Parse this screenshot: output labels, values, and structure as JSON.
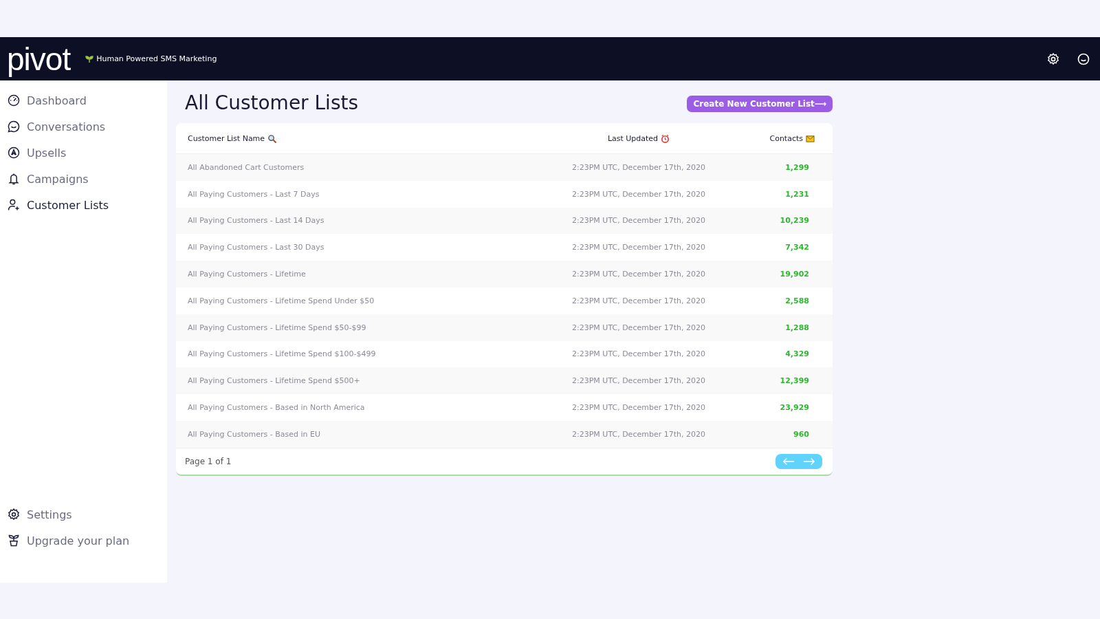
{
  "header": {
    "logo": "pivot",
    "tagline": "Human Powered SMS Marketing"
  },
  "sidebar": {
    "items": [
      {
        "label": "Dashboard",
        "selected": false
      },
      {
        "label": "Conversations",
        "selected": false
      },
      {
        "label": "Upsells",
        "selected": false
      },
      {
        "label": "Campaigns",
        "selected": false
      },
      {
        "label": "Customer Lists",
        "selected": true
      }
    ],
    "bottom_items": [
      {
        "label": "Settings"
      },
      {
        "label": "Upgrade your plan"
      }
    ]
  },
  "page": {
    "title": "All Customer Lists",
    "create_button": "Create New Customer List⟶"
  },
  "table": {
    "columns": [
      {
        "label": "Customer List Name"
      },
      {
        "label": "Last Updated"
      },
      {
        "label": "Contacts"
      }
    ],
    "rows": [
      [
        "All Abandoned Cart Customers",
        "2:23PM UTC, December 17th, 2020",
        "1,299"
      ],
      [
        "All Paying Customers - Last 7 Days",
        "2:23PM UTC, December 17th, 2020",
        "1,231"
      ],
      [
        "All Paying Customers - Last 14 Days",
        "2:23PM UTC, December 17th, 2020",
        "10,239"
      ],
      [
        "All Paying Customers - Last 30 Days",
        "2:23PM UTC, December 17th, 2020",
        "7,342"
      ],
      [
        "All Paying Customers - Lifetime",
        "2:23PM UTC, December 17th, 2020",
        "19,902"
      ],
      [
        "All Paying Customers - Lifetime Spend Under $50",
        "2:23PM UTC, December 17th, 2020",
        "2,588"
      ],
      [
        "All Paying Customers - Lifetime Spend $50-$99",
        "2:23PM UTC, December 17th, 2020",
        "1,288"
      ],
      [
        "All Paying Customers - Lifetime Spend $100-$499",
        "2:23PM UTC, December 17th, 2020",
        "4,329"
      ],
      [
        "All Paying Customers - Lifetime Spend $500+",
        "2:23PM UTC, December 17th, 2020",
        "12,399"
      ],
      [
        "All Paying Customers - Based in North America",
        "2:23PM UTC, December 17th, 2020",
        "23,929"
      ],
      [
        "All Paying Customers - Based in EU",
        "2:23PM UTC, December 17th, 2020",
        "960"
      ]
    ],
    "pagination": "Page 1 of 1"
  }
}
